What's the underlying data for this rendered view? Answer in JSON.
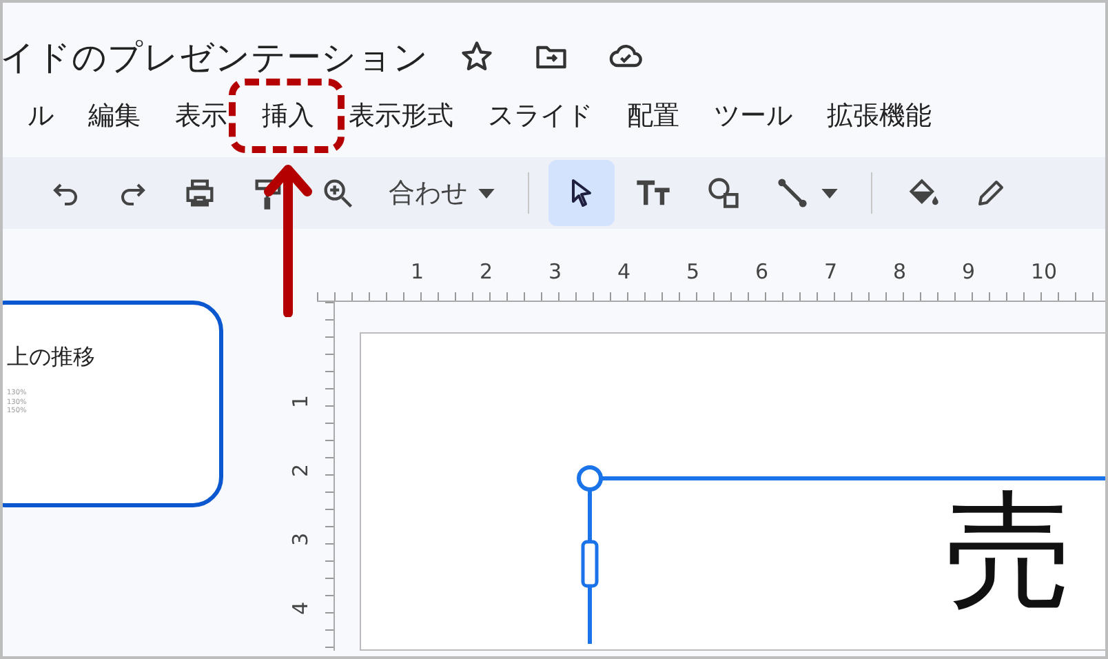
{
  "document": {
    "title": "イドのプレゼンテーション"
  },
  "menu": [
    {
      "label": "ル",
      "highlighted": false
    },
    {
      "label": "編集",
      "highlighted": false
    },
    {
      "label": "表示",
      "highlighted": false
    },
    {
      "label": "挿入",
      "highlighted": true
    },
    {
      "label": "表示形式",
      "highlighted": false
    },
    {
      "label": "スライド",
      "highlighted": false
    },
    {
      "label": "配置",
      "highlighted": false
    },
    {
      "label": "ツール",
      "highlighted": false
    },
    {
      "label": "拡張機能",
      "highlighted": false
    }
  ],
  "toolbar": {
    "zoom_label": "合わせ",
    "select_tool": {
      "selected": true
    }
  },
  "ruler": {
    "horizontal": [
      "1",
      "2",
      "3",
      "4",
      "5",
      "6",
      "7",
      "8",
      "9",
      "10"
    ],
    "vertical": [
      "1",
      "2",
      "3",
      "4"
    ]
  },
  "thumbnail": {
    "selected": true,
    "title": "上の推移",
    "lines": [
      "130%",
      "130%",
      "150%"
    ]
  },
  "slide": {
    "text": "売"
  }
}
